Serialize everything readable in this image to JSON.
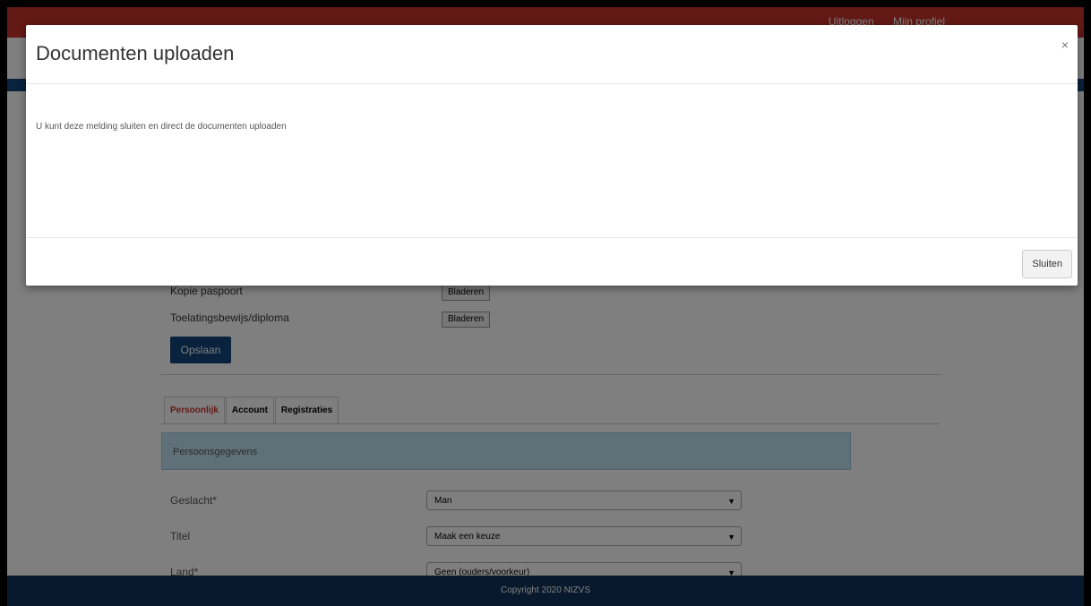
{
  "topbar": {
    "links": [
      "Uitloggen",
      "Mijn profiel"
    ]
  },
  "form": {
    "file_rows": [
      {
        "label": "Kopie paspoort",
        "button": "Bladeren"
      },
      {
        "label": "Toelatingsbewijs/diploma",
        "button": "Bladeren"
      }
    ],
    "save_label": "Opslaan",
    "tabs": [
      "Persoonlijk",
      "Account",
      "Registraties"
    ],
    "panel_title": "Persoonsgegevens",
    "fields": [
      {
        "label": "Geslacht*",
        "value": "Man"
      },
      {
        "label": "Titel",
        "value": "Maak een keuze"
      },
      {
        "label": "Land*",
        "value": "Geen (ouders/voorkeur)"
      }
    ]
  },
  "footer": {
    "text": "Copyright 2020 NIZVS"
  },
  "modal": {
    "title": "Documenten uploaden",
    "close_icon": "×",
    "body": "U kunt deze melding sluiten en direct de documenten uploaden",
    "close_label": "Sluiten"
  }
}
